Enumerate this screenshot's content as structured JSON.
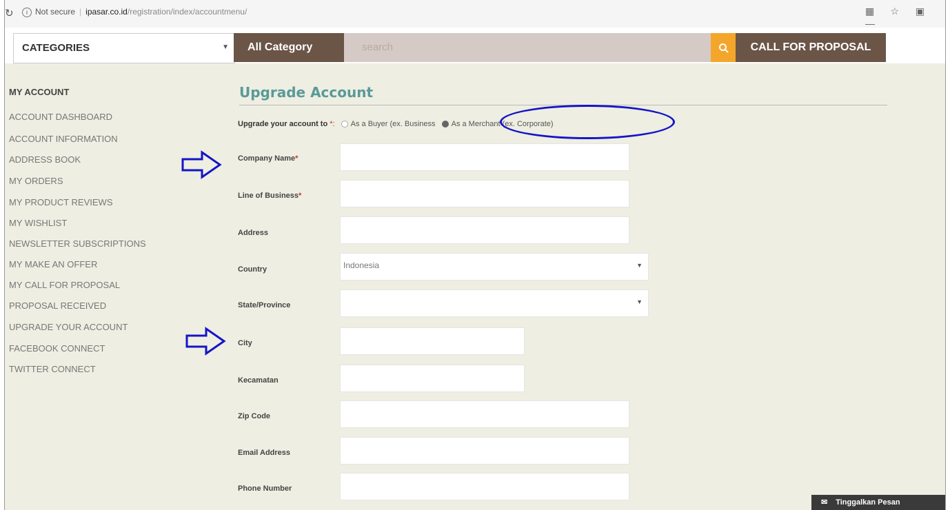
{
  "browser": {
    "url_security": "Not secure",
    "url_host": "ipasar.co.id",
    "url_path": "/registration/index/accountmenu/"
  },
  "header": {
    "categories_label": "CATEGORIES",
    "all_category_label": "All Category",
    "search_placeholder": "search",
    "call_for_proposal_label": "CALL FOR PROPOSAL"
  },
  "sidebar": {
    "heading": "MY ACCOUNT",
    "items": [
      {
        "label": "ACCOUNT DASHBOARD"
      },
      {
        "label": "ACCOUNT INFORMATION"
      },
      {
        "label": "ADDRESS BOOK"
      },
      {
        "label": "MY ORDERS"
      },
      {
        "label": "MY PRODUCT REVIEWS"
      },
      {
        "label": "MY WISHLIST"
      },
      {
        "label": "NEWSLETTER SUBSCRIPTIONS"
      },
      {
        "label": "MY MAKE AN OFFER"
      },
      {
        "label": "MY CALL FOR PROPOSAL"
      },
      {
        "label": "PROPOSAL RECEIVED"
      },
      {
        "label": "UPGRADE YOUR ACCOUNT"
      },
      {
        "label": "FACEBOOK CONNECT"
      },
      {
        "label": "TWITTER CONNECT"
      }
    ]
  },
  "main": {
    "title": "Upgrade Account",
    "upgrade_label": "Upgrade your account to",
    "upgrade_required": "*:",
    "option_buyer": "As a Buyer (ex. Business",
    "option_merchant": "As a Merchant (ex. Corporate)",
    "selected_option": "merchant",
    "fields": {
      "company_name": {
        "label": "Company Name",
        "required": "*",
        "value": ""
      },
      "line_of_business": {
        "label": "Line of Business",
        "required": "*",
        "value": ""
      },
      "address": {
        "label": "Address",
        "value": ""
      },
      "country": {
        "label": "Country",
        "value": "Indonesia"
      },
      "state": {
        "label": "State/Province",
        "value": ""
      },
      "city": {
        "label": "City",
        "value": ""
      },
      "kecamatan": {
        "label": "Kecamatan",
        "value": ""
      },
      "zip": {
        "label": "Zip Code",
        "value": ""
      },
      "email": {
        "label": "Email Address",
        "value": ""
      },
      "phone": {
        "label": "Phone Number",
        "value": ""
      }
    }
  },
  "chat": {
    "label": "Tinggalkan Pesan"
  },
  "annotations": {
    "circle_color": "#1414c8",
    "arrow_color": "#1414c8"
  },
  "colors": {
    "brown": "#6b5547",
    "search_bg": "#d5cac6",
    "search_button": "#f4a62a",
    "title_teal": "#5a9a98",
    "page_bg": "#eeeee2"
  }
}
